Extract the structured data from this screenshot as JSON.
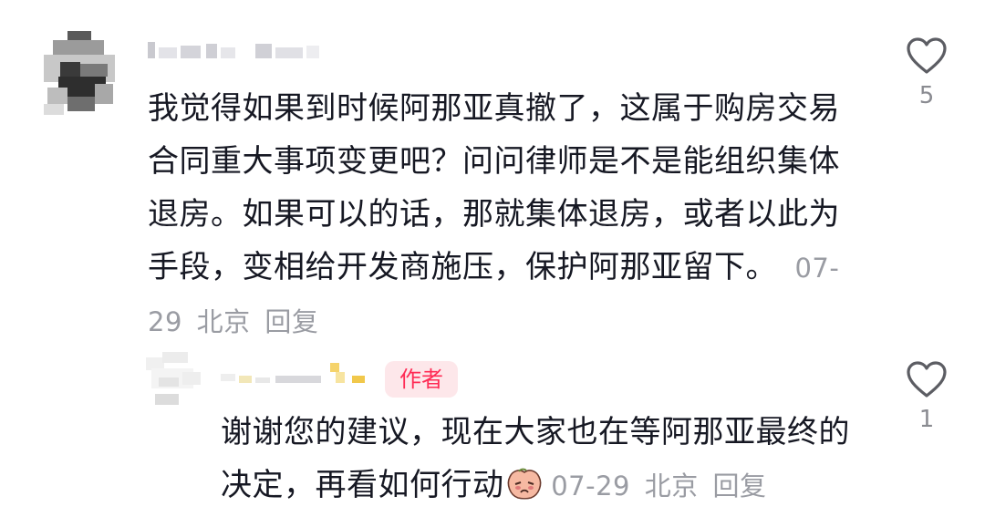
{
  "comment": {
    "text": "我觉得如果到时候阿那亚真撤了，这属于购房交易合同重大事项变更吧？问问律师是不是能组织集体退房。如果可以的话，那就集体退房，或者以此为手段，变相给开发商施压，保护阿那亚留下。",
    "date": "07-29",
    "location": "北京",
    "reply_label": "回复",
    "like_count": "5",
    "like_icon": "heart-outline-icon"
  },
  "reply": {
    "badge": "作者",
    "text": "谢谢您的建议，现在大家也在等阿那亚最终的决定，再看如何行动",
    "emoji": "crying-peach-emoji",
    "date": "07-29",
    "location": "北京",
    "reply_label": "回复",
    "like_count": "1",
    "like_icon": "heart-outline-icon"
  },
  "colors": {
    "text": "#161823",
    "meta": "#9a9ca3",
    "badge_bg": "#fde7ea",
    "badge_text": "#fe2c55",
    "heart_stroke": "#5c5d63"
  }
}
